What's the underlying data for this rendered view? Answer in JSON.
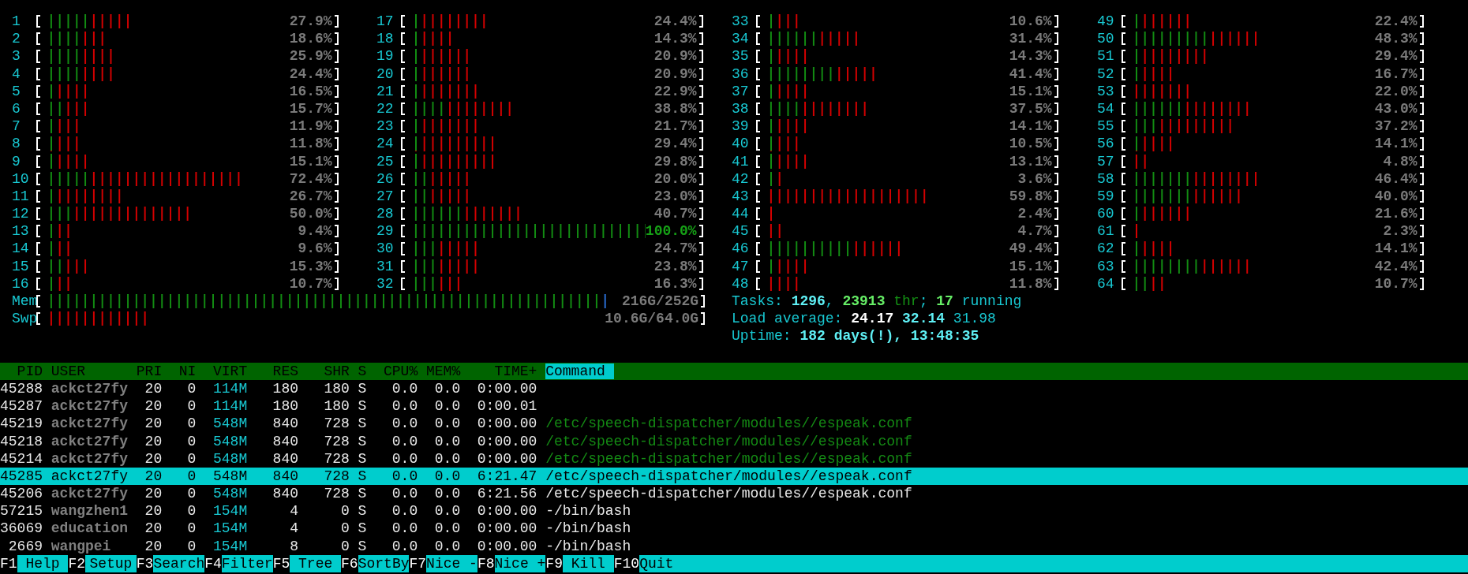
{
  "cpus": [
    {
      "label": "1",
      "reading": "27.9%",
      "level": 0.303,
      "user": {
        "level": 0.152
      }
    },
    {
      "label": "2",
      "reading": "18.6%",
      "level": 0.212,
      "user": {
        "level": 0.121
      }
    },
    {
      "label": "3",
      "reading": "25.9%",
      "level": 0.242,
      "user": {
        "level": 0.121
      }
    },
    {
      "label": "4",
      "reading": "24.4%",
      "level": 0.242,
      "user": {
        "level": 0.121
      }
    },
    {
      "label": "5",
      "reading": "16.5%",
      "level": 0.152,
      "user": {
        "level": 0.03
      }
    },
    {
      "label": "6",
      "reading": "15.7%",
      "level": 0.152,
      "user": {
        "level": 0.061
      }
    },
    {
      "label": "7",
      "reading": "11.9%",
      "level": 0.121,
      "user": {
        "level": 0.03
      }
    },
    {
      "label": "8",
      "reading": "11.8%",
      "level": 0.121,
      "user": {
        "level": 0.03
      }
    },
    {
      "label": "9",
      "reading": "15.1%",
      "level": 0.152,
      "user": {
        "level": 0.03
      }
    },
    {
      "label": "10",
      "reading": "72.4%",
      "level": 0.697,
      "user": {
        "level": 0.152
      }
    },
    {
      "label": "11",
      "reading": "26.7%",
      "level": 0.273,
      "user": {
        "level": 0.03
      }
    },
    {
      "label": "12",
      "reading": "50.0%",
      "level": 0.515,
      "user": {
        "level": 0.091
      }
    },
    {
      "label": "13",
      "reading": "9.4%",
      "level": 0.091,
      "user": {
        "level": 0.03
      }
    },
    {
      "label": "14",
      "reading": "9.6%",
      "level": 0.091,
      "user": {
        "level": 0.03
      }
    },
    {
      "label": "15",
      "reading": "15.3%",
      "level": 0.152,
      "user": {
        "level": 0.061
      }
    },
    {
      "label": "16",
      "reading": "10.7%",
      "level": 0.091,
      "user": {
        "level": 0.03
      }
    },
    {
      "label": "17",
      "reading": "24.4%",
      "level": 0.273,
      "user": {
        "level": 0.03
      }
    },
    {
      "label": "18",
      "reading": "14.3%",
      "level": 0.152,
      "user": {
        "level": 0.03
      }
    },
    {
      "label": "19",
      "reading": "20.9%",
      "level": 0.212,
      "user": {
        "level": 0.03
      }
    },
    {
      "label": "20",
      "reading": "20.9%",
      "level": 0.212,
      "user": {
        "level": 0.03
      }
    },
    {
      "label": "21",
      "reading": "22.9%",
      "level": 0.242,
      "user": {
        "level": 0.03
      }
    },
    {
      "label": "22",
      "reading": "38.8%",
      "level": 0.364,
      "user": {
        "level": 0.121
      }
    },
    {
      "label": "23",
      "reading": "21.7%",
      "level": 0.242,
      "user": {
        "level": 0.03
      }
    },
    {
      "label": "24",
      "reading": "29.4%",
      "level": 0.303,
      "user": {
        "level": 0.03
      }
    },
    {
      "label": "25",
      "reading": "29.8%",
      "level": 0.303,
      "user": {
        "level": 0.03
      }
    },
    {
      "label": "26",
      "reading": "20.0%",
      "level": 0.212,
      "user": {
        "level": 0.061
      }
    },
    {
      "label": "27",
      "reading": "23.0%",
      "level": 0.212,
      "user": {
        "level": 0.061
      }
    },
    {
      "label": "28",
      "reading": "40.7%",
      "level": 0.394,
      "user": {
        "level": 0.182
      }
    },
    {
      "label": "29",
      "reading": "100.0%",
      "level": 1,
      "user": {
        "level": 1
      }
    },
    {
      "label": "30",
      "reading": "24.7%",
      "level": 0.242,
      "user": {
        "level": 0.091
      }
    },
    {
      "label": "31",
      "reading": "23.8%",
      "level": 0.242,
      "user": {
        "level": 0.091
      }
    },
    {
      "label": "32",
      "reading": "16.3%",
      "level": 0.182,
      "user": {
        "level": 0.091
      }
    },
    {
      "label": "33",
      "reading": "10.6%",
      "level": 0.121,
      "user": {
        "level": 0.03
      }
    },
    {
      "label": "34",
      "reading": "31.4%",
      "level": 0.333,
      "user": {
        "level": 0.182
      }
    },
    {
      "label": "35",
      "reading": "14.3%",
      "level": 0.152,
      "user": {
        "level": 0.03
      }
    },
    {
      "label": "36",
      "reading": "41.4%",
      "level": 0.394,
      "user": {
        "level": 0.242
      }
    },
    {
      "label": "37",
      "reading": "15.1%",
      "level": 0.152,
      "user": {
        "level": 0.03
      }
    },
    {
      "label": "38",
      "reading": "37.5%",
      "level": 0.364,
      "user": {
        "level": 0.121
      }
    },
    {
      "label": "39",
      "reading": "14.1%",
      "level": 0.152,
      "user": {
        "level": 0.03
      }
    },
    {
      "label": "40",
      "reading": "10.5%",
      "level": 0.121,
      "user": {
        "level": 0.03
      }
    },
    {
      "label": "41",
      "reading": "13.1%",
      "level": 0.152,
      "user": {
        "level": 0.03
      }
    },
    {
      "label": "42",
      "reading": "3.6%",
      "level": 0.061,
      "user": {
        "level": 0.03
      }
    },
    {
      "label": "43",
      "reading": "59.8%",
      "level": 0.576
    },
    {
      "label": "44",
      "reading": "2.4%",
      "level": 0.03
    },
    {
      "label": "45",
      "reading": "4.7%",
      "level": 0.061
    },
    {
      "label": "46",
      "reading": "49.4%",
      "level": 0.485,
      "user": {
        "level": 0.303
      }
    },
    {
      "label": "47",
      "reading": "15.1%",
      "level": 0.152,
      "user": {
        "level": 0.03
      }
    },
    {
      "label": "48",
      "reading": "11.8%",
      "level": 0.121
    },
    {
      "label": "49",
      "reading": "22.4%",
      "level": 0.212,
      "user": {
        "level": 0.03
      }
    },
    {
      "label": "50",
      "reading": "48.3%",
      "level": 0.455,
      "user": {
        "level": 0.273
      }
    },
    {
      "label": "51",
      "reading": "29.4%",
      "level": 0.273,
      "user": {
        "level": 0.03
      }
    },
    {
      "label": "52",
      "reading": "16.7%",
      "level": 0.152,
      "user": {
        "level": 0.03
      }
    },
    {
      "label": "53",
      "reading": "22.0%",
      "level": 0.212
    },
    {
      "label": "54",
      "reading": "43.0%",
      "level": 0.424,
      "user": {
        "level": 0.182
      }
    },
    {
      "label": "55",
      "reading": "37.2%",
      "level": 0.364,
      "user": {
        "level": 0.091
      }
    },
    {
      "label": "56",
      "reading": "14.1%",
      "level": 0.152,
      "user": {
        "level": 0.03
      }
    },
    {
      "label": "57",
      "reading": "4.8%",
      "level": 0.061
    },
    {
      "label": "58",
      "reading": "46.4%",
      "level": 0.455,
      "user": {
        "level": 0.212
      }
    },
    {
      "label": "59",
      "reading": "40.0%",
      "level": 0.394,
      "user": {
        "level": 0.212
      }
    },
    {
      "label": "60",
      "reading": "21.6%",
      "level": 0.212,
      "user": {
        "level": 0.03
      }
    },
    {
      "label": "61",
      "reading": "2.3%",
      "level": 0.03
    },
    {
      "label": "62",
      "reading": "14.1%",
      "level": 0.152,
      "user": {
        "level": 0.03
      }
    },
    {
      "label": "63",
      "reading": "42.4%",
      "level": 0.424,
      "user": {
        "level": 0.242
      }
    },
    {
      "label": "64",
      "reading": "10.7%",
      "level": 0.121,
      "user": {
        "level": 0.061
      }
    }
  ],
  "memory": {
    "label": "Mem",
    "reading": "216G/252G",
    "level": 0.868,
    "used": {
      "level": 0.855
    }
  },
  "swap": {
    "label": "Swp",
    "reading": "10.6G/64.0G",
    "level": 0.158
  },
  "tasks": [
    {
      "kind": "label",
      "text": "Tasks: "
    },
    {
      "kind": "value",
      "text": "1296"
    },
    {
      "kind": "label",
      "text": ", "
    },
    {
      "kind": "thread_value",
      "text": "23913"
    },
    {
      "kind": "thread_label",
      "text": " thr"
    },
    {
      "kind": "label",
      "text": "; "
    },
    {
      "kind": "running_value",
      "text": "17"
    },
    {
      "kind": "label",
      "text": " running"
    }
  ],
  "load_average": [
    {
      "kind": "label",
      "text": "Load average: "
    },
    {
      "kind": "load1",
      "text": "24.17"
    },
    {
      "kind": "value",
      "text": " 32.14"
    },
    {
      "kind": "label",
      "text": " 31.98"
    }
  ],
  "uptime": [
    {
      "kind": "label",
      "text": "Uptime: "
    },
    {
      "kind": "value",
      "text": "182 days(!), 13:48:35"
    }
  ],
  "table": {
    "columns": [
      {
        "label": "PID",
        "selected": false
      },
      {
        "label": "USER",
        "selected": false
      },
      {
        "label": "PRI",
        "selected": false
      },
      {
        "label": "NI",
        "selected": false
      },
      {
        "label": "VIRT",
        "selected": false
      },
      {
        "label": "RES",
        "selected": false
      },
      {
        "label": "SHR",
        "selected": false
      },
      {
        "label": "S",
        "selected": false
      },
      {
        "label": "CPU%",
        "selected": false
      },
      {
        "label": "MEM%",
        "selected": false
      },
      {
        "label": "TIME+",
        "selected": false
      },
      {
        "label": "Command",
        "selected": true
      }
    ],
    "rows": [
      {
        "selected": false,
        "pid": "45288",
        "user": "ackct27fy",
        "pri": "20",
        "ni": "0",
        "virt": "114M",
        "res": "180",
        "shr": "180",
        "s": "S",
        "cpu": "0.0",
        "mem": "0.0",
        "time": "0:00.00"
      },
      {
        "selected": false,
        "pid": "45287",
        "user": "ackct27fy",
        "pri": "20",
        "ni": "0",
        "virt": "114M",
        "res": "180",
        "shr": "180",
        "s": "S",
        "cpu": "0.0",
        "mem": "0.0",
        "time": "0:00.01"
      },
      {
        "kind": "thread",
        "selected": false,
        "pid": "45219",
        "user": "ackct27fy",
        "pri": "20",
        "ni": "0",
        "virt": "548M",
        "res": "840",
        "shr": "728",
        "s": "S",
        "cpu": "0.0",
        "mem": "0.0",
        "time": "0:00.00",
        "command": "/etc/speech-dispatcher/modules//espeak.conf"
      },
      {
        "kind": "thread",
        "selected": false,
        "pid": "45218",
        "user": "ackct27fy",
        "pri": "20",
        "ni": "0",
        "virt": "548M",
        "res": "840",
        "shr": "728",
        "s": "S",
        "cpu": "0.0",
        "mem": "0.0",
        "time": "0:00.00",
        "command": "/etc/speech-dispatcher/modules//espeak.conf"
      },
      {
        "kind": "thread",
        "selected": false,
        "pid": "45214",
        "user": "ackct27fy",
        "pri": "20",
        "ni": "0",
        "virt": "548M",
        "res": "840",
        "shr": "728",
        "s": "S",
        "cpu": "0.0",
        "mem": "0.0",
        "time": "0:00.00",
        "command": "/etc/speech-dispatcher/modules//espeak.conf"
      },
      {
        "kind": "process",
        "selected": true,
        "pid": "45285",
        "user": "ackct27fy",
        "pri": "20",
        "ni": "0",
        "virt": "548M",
        "res": "840",
        "shr": "728",
        "s": "S",
        "cpu": "0.0",
        "mem": "0.0",
        "time": "6:21.47",
        "command": "/etc/speech-dispatcher/modules//espeak.conf"
      },
      {
        "kind": "process",
        "selected": false,
        "pid": "45206",
        "user": "ackct27fy",
        "pri": "20",
        "ni": "0",
        "virt": "548M",
        "res": "840",
        "shr": "728",
        "s": "S",
        "cpu": "0.0",
        "mem": "0.0",
        "time": "6:21.56",
        "command": "/etc/speech-dispatcher/modules//espeak.conf"
      },
      {
        "kind": "process",
        "selected": false,
        "pid": "57215",
        "user": "wangzhen1",
        "pri": "20",
        "ni": "0",
        "virt": "154M",
        "res": "4",
        "shr": "0",
        "s": "S",
        "cpu": "0.0",
        "mem": "0.0",
        "time": "0:00.00",
        "command": "-/bin/bash"
      },
      {
        "kind": "process",
        "selected": false,
        "pid": "36069",
        "user": "education",
        "pri": "20",
        "ni": "0",
        "virt": "154M",
        "res": "4",
        "shr": "0",
        "s": "S",
        "cpu": "0.0",
        "mem": "0.0",
        "time": "0:00.00",
        "command": "-/bin/bash"
      },
      {
        "kind": "process",
        "selected": false,
        "pid": "2669",
        "user": "wangpei",
        "pri": "20",
        "ni": "0",
        "virt": "154M",
        "res": "8",
        "shr": "0",
        "s": "S",
        "cpu": "0.0",
        "mem": "0.0",
        "time": "0:00.00",
        "command": "-/bin/bash"
      }
    ]
  },
  "function_keys": [
    {
      "key": "F1",
      "label": "Help"
    },
    {
      "key": "F2",
      "label": "Setup"
    },
    {
      "key": "F3",
      "label": "Search"
    },
    {
      "key": "F4",
      "label": "Filter"
    },
    {
      "key": "F5",
      "label": "Tree"
    },
    {
      "key": "F6",
      "label": "SortBy"
    },
    {
      "key": "F7",
      "label": "Nice -"
    },
    {
      "key": "F8",
      "label": "Nice +"
    },
    {
      "key": "F9",
      "label": "Kill"
    },
    {
      "key": "F10",
      "label": "Quit"
    }
  ]
}
